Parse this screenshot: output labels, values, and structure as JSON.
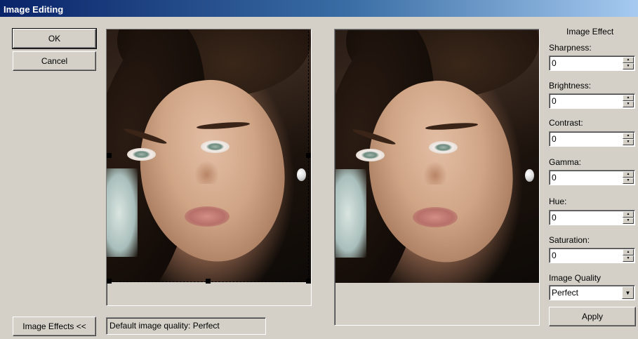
{
  "window": {
    "title": "Image Editing"
  },
  "buttons": {
    "ok": "OK",
    "cancel": "Cancel",
    "image_effects": "Image Effects <<",
    "apply": "Apply"
  },
  "status": {
    "text": "Default image quality: Perfect"
  },
  "effects": {
    "heading": "Image Effect",
    "sharpness": {
      "label": "Sharpness:",
      "value": "0"
    },
    "brightness": {
      "label": "Brightness:",
      "value": "0"
    },
    "contrast": {
      "label": "Contrast:",
      "value": "0"
    },
    "gamma": {
      "label": "Gamma:",
      "value": "0"
    },
    "hue": {
      "label": "Hue:",
      "value": "0"
    },
    "saturation": {
      "label": "Saturation:",
      "value": "0"
    },
    "quality": {
      "label": "Image Quality",
      "value": "Perfect"
    }
  },
  "icons": {
    "spin_up": "triangle-up",
    "spin_down": "triangle-down",
    "dropdown": "triangle-down"
  },
  "colors": {
    "titlebar_start": "#0a246a",
    "titlebar_end": "#a6caf0",
    "face": "#d0a586",
    "hair": "#1b120c",
    "eye": "#9fb4a8"
  }
}
